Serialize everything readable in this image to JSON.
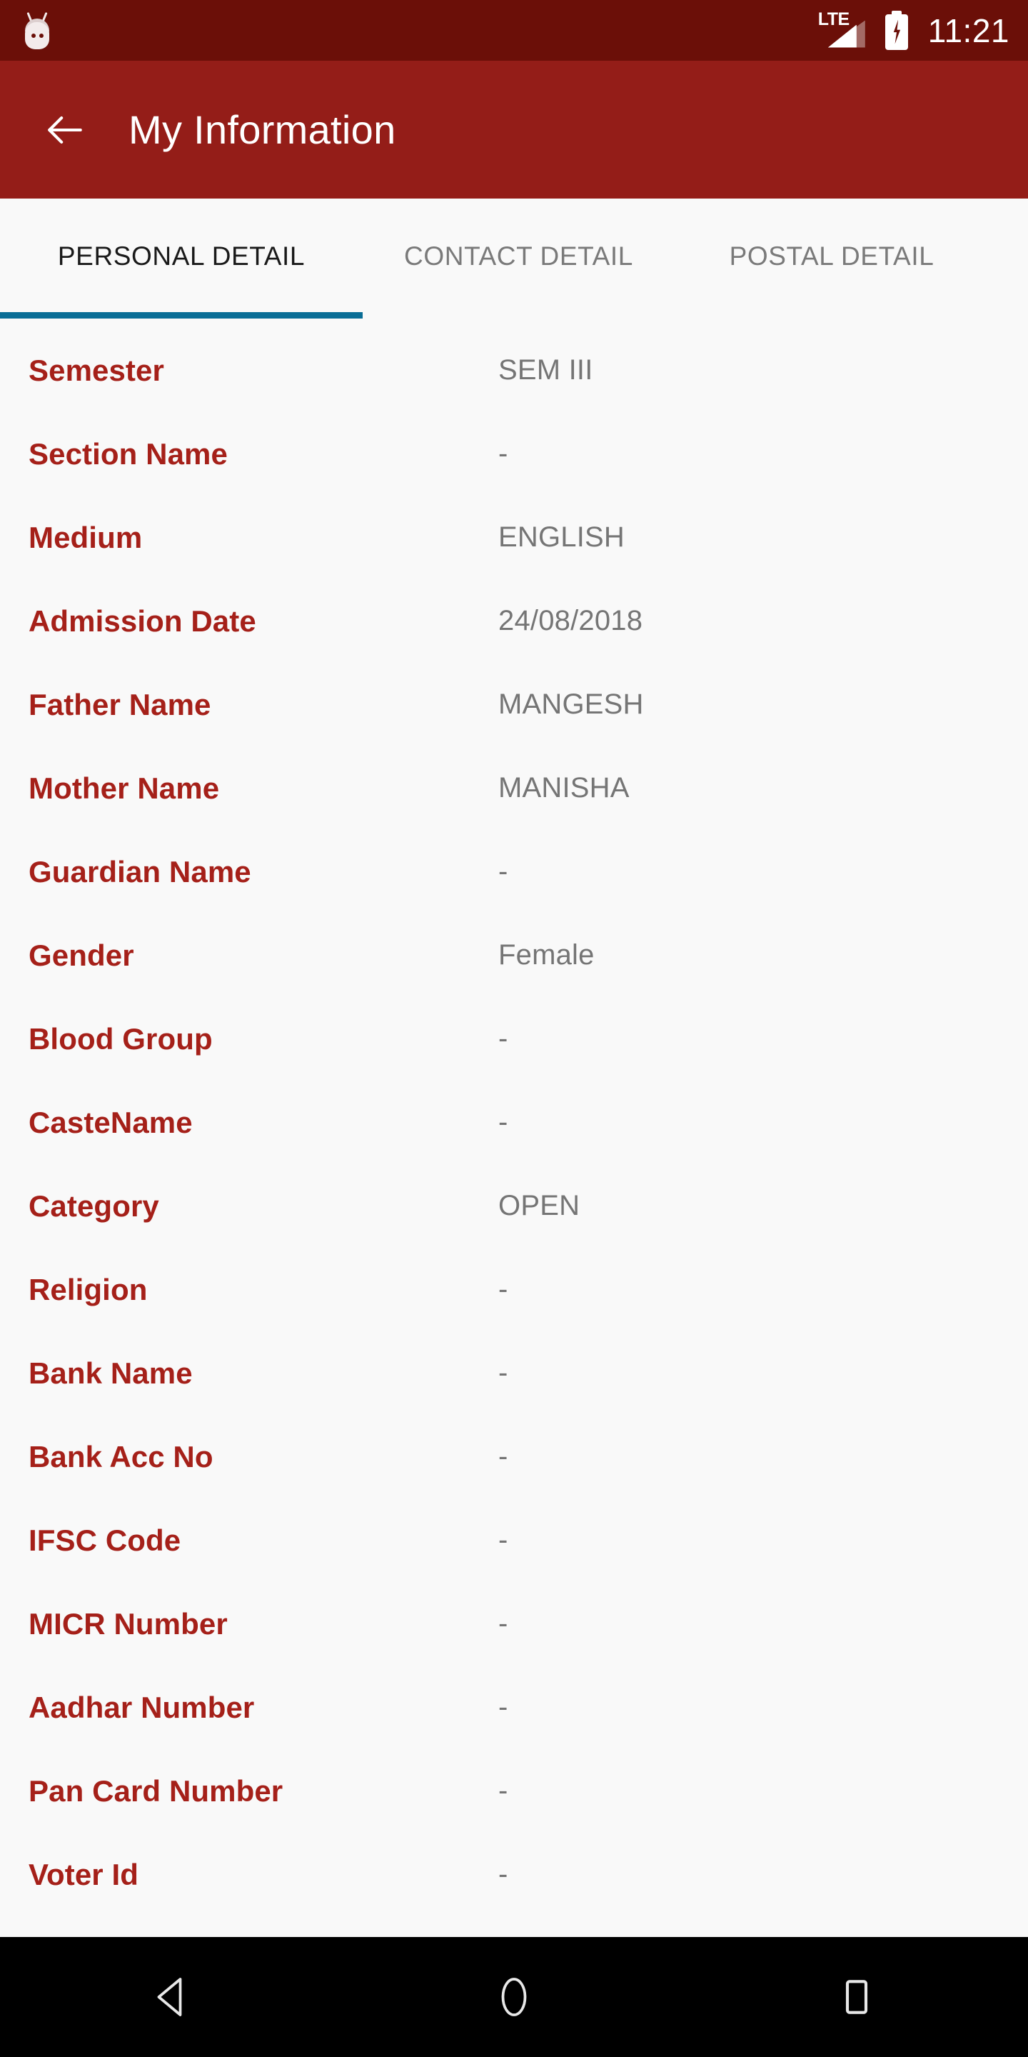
{
  "status_bar": {
    "app_icon": "android-marshmallow-icon",
    "network_label": "LTE",
    "signal_icon": "signal-bars-icon",
    "battery_icon": "battery-charging-icon",
    "time": "11:21"
  },
  "app_bar": {
    "back_icon": "back-arrow-icon",
    "title": "My Information"
  },
  "tabs": {
    "active_index": 0,
    "items": [
      {
        "label": "PERSONAL DETAIL"
      },
      {
        "label": "CONTACT DETAIL"
      },
      {
        "label": "POSTAL DETAIL"
      }
    ]
  },
  "details": {
    "rows": [
      {
        "label": "Semester",
        "value": "SEM III"
      },
      {
        "label": "Section Name",
        "value": "-"
      },
      {
        "label": "Medium",
        "value": "ENGLISH"
      },
      {
        "label": "Admission Date",
        "value": "24/08/2018"
      },
      {
        "label": "Father Name",
        "value": "MANGESH"
      },
      {
        "label": "Mother Name",
        "value": "MANISHA"
      },
      {
        "label": "Guardian Name",
        "value": "-"
      },
      {
        "label": "Gender",
        "value": "Female"
      },
      {
        "label": "Blood Group",
        "value": "-"
      },
      {
        "label": "CasteName",
        "value": "-"
      },
      {
        "label": "Category",
        "value": "OPEN"
      },
      {
        "label": "Religion",
        "value": "-"
      },
      {
        "label": "Bank Name",
        "value": "-"
      },
      {
        "label": "Bank Acc No",
        "value": "-"
      },
      {
        "label": "IFSC Code",
        "value": "-"
      },
      {
        "label": "MICR Number",
        "value": "-"
      },
      {
        "label": "Aadhar Number",
        "value": "-"
      },
      {
        "label": "Pan Card Number",
        "value": "-"
      },
      {
        "label": "Voter Id",
        "value": "-"
      }
    ]
  },
  "nav_bar": {
    "back_icon": "nav-back-triangle-icon",
    "home_icon": "nav-home-circle-icon",
    "recents_icon": "nav-recents-square-icon"
  },
  "colors": {
    "status_bar_bg": "#6b0f08",
    "app_bar_bg": "#941d18",
    "page_bg": "#f9f9f9",
    "label_red": "#a52019",
    "value_gray": "#757575",
    "tab_active_underline": "#0a6e96",
    "tab_inactive_text": "#7a7a7a",
    "nav_bar_bg": "#000000"
  }
}
